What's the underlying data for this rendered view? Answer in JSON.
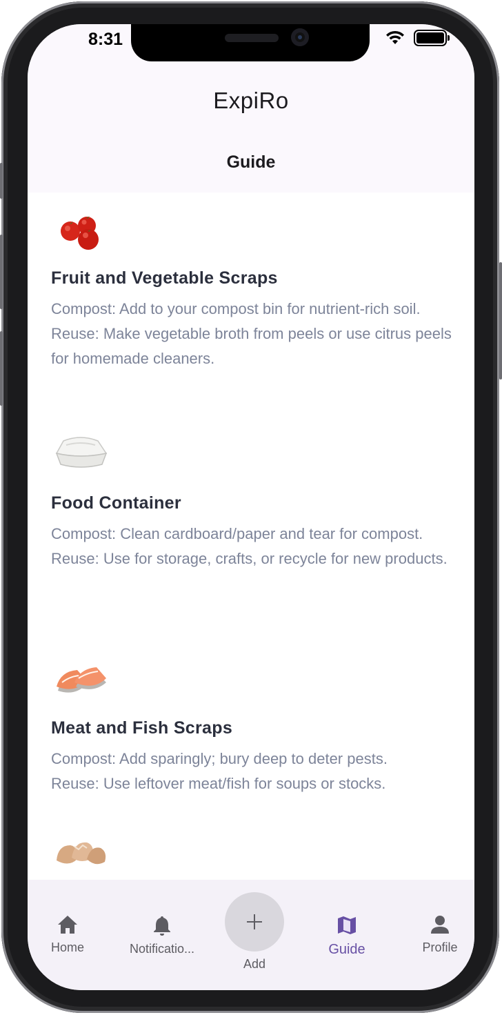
{
  "status_bar": {
    "time": "8:31"
  },
  "header": {
    "app_title": "ExpiRo",
    "page_title": "Guide"
  },
  "guide_items": [
    {
      "image": "tomatoes",
      "title": "Fruit and Vegetable Scraps",
      "lines": [
        "Compost: Add to your compost bin for nutrient-rich soil.",
        "Reuse: Make vegetable broth from peels or use citrus peels for homemade cleaners."
      ]
    },
    {
      "image": "foam-takeout-container",
      "title": "Food Container",
      "lines": [
        "Compost: Clean cardboard/paper and tear for compost.",
        "Reuse: Use for storage, crafts, or recycle for new products."
      ]
    },
    {
      "image": "salmon-steaks",
      "title": "Meat and Fish Scraps",
      "lines": [
        "Compost: Add sparingly; bury deep to deter pests.",
        "Reuse: Use leftover meat/fish for soups or stocks."
      ]
    },
    {
      "image": "eggshells"
    }
  ],
  "bottom_nav": {
    "items": [
      {
        "label": "Home",
        "icon": "home-icon"
      },
      {
        "label": "Notificatio...",
        "icon": "bell-icon"
      },
      {
        "label": "Add",
        "icon": "plus-icon"
      },
      {
        "label": "Guide",
        "icon": "map-icon",
        "active": true
      },
      {
        "label": "Profile",
        "icon": "person-icon"
      }
    ]
  },
  "colors": {
    "accent": "#6750a4",
    "title_text": "#2b2f3d",
    "body_text": "#7d8499"
  }
}
